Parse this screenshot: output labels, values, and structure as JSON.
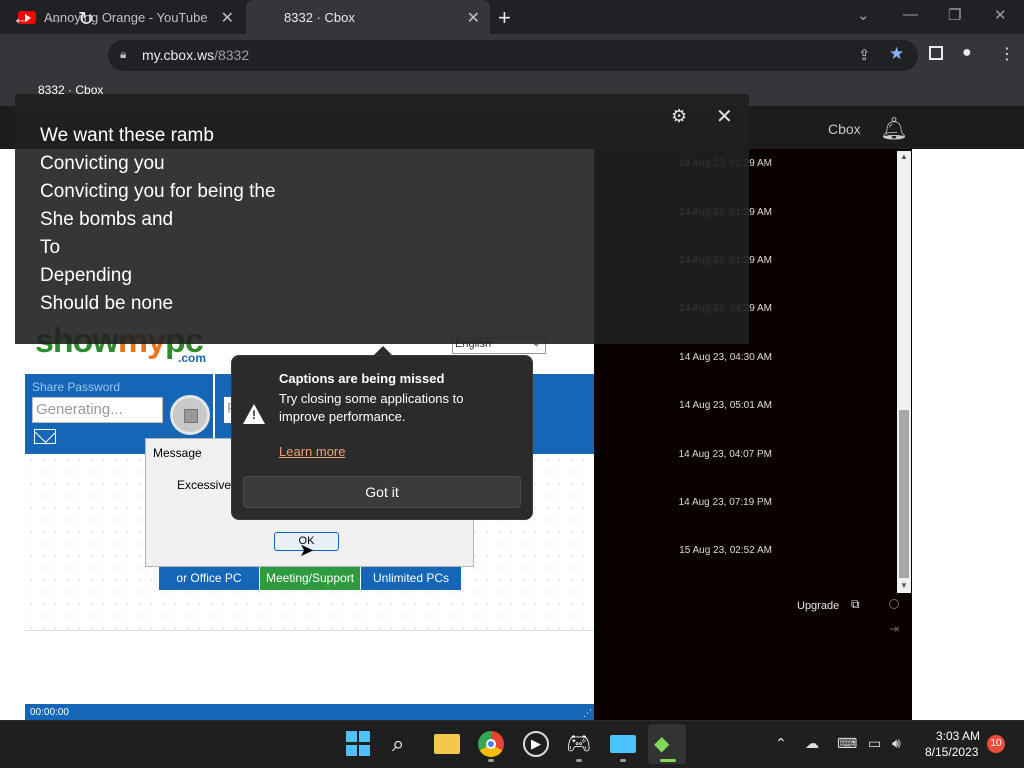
{
  "browser": {
    "tabs": [
      {
        "title": "Annoying Orange - YouTube",
        "active": false
      },
      {
        "title": "8332 · Cbox",
        "active": true
      }
    ],
    "new_tab": "+",
    "address_host": "my.cbox.ws",
    "address_path": "/8332",
    "tooltip_title": "8332 · Cbox"
  },
  "cbox": {
    "brand": "Cbox",
    "timestamps": [
      "14 Aug 23, 01:29 AM",
      "14 Aug 23, 01:29 AM",
      "14 Aug 23, 01:29 AM",
      "14 Aug 23, 04:29 AM",
      "14 Aug 23, 04:30 AM",
      "14 Aug 23, 05:01 AM",
      "14 Aug 23, 04:07 PM",
      "14 Aug 23, 07:19 PM",
      "15 Aug 23, 02:52 AM"
    ],
    "upgrade": "Upgrade"
  },
  "remote": {
    "logo_show": "show",
    "logo_my": "my",
    "logo_pc": "pc",
    "logo_com": ".com",
    "language": "English",
    "share_label": "Share Password",
    "generating": "Generating...",
    "second_input": "P",
    "buttons": [
      "or Office PC",
      "Meeting/Support",
      "Unlimited PCs"
    ],
    "timer": "00:00:00"
  },
  "message_box": {
    "title": "Message",
    "text": "Excessive U",
    "ok": "OK"
  },
  "live_caption": {
    "lines": [
      "We want these ramb",
      "Convicting you",
      "Convicting you for being the",
      "She bombs and",
      "To",
      "Depending",
      "Should be none"
    ]
  },
  "flyout": {
    "title": "Captions are being missed",
    "body": "Try closing some applications to improve performance.",
    "link": "Learn more",
    "button": "Got it"
  },
  "taskbar": {
    "time": "3:03 AM",
    "date": "8/15/2023",
    "notifications": "10"
  },
  "colors": {
    "accent": "#1566b7",
    "green_button": "#2e9b3e",
    "chat_bg": "#0a0000"
  }
}
